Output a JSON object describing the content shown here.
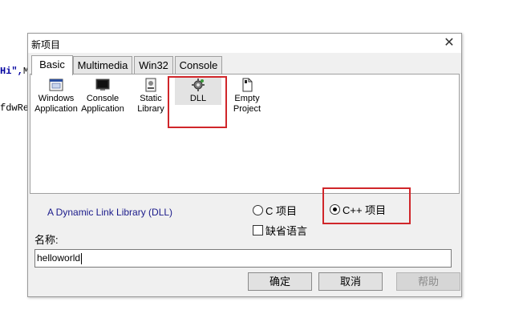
{
  "background": {
    "code_line1_str": "Hi\",",
    "code_line1_rest": "M",
    "code_line2": "fdwRe"
  },
  "dialog": {
    "title": "新项目",
    "close_glyph": "✕",
    "tabs": [
      {
        "label": "Basic",
        "active": true
      },
      {
        "label": "Multimedia",
        "active": false
      },
      {
        "label": "Win32",
        "active": false
      },
      {
        "label": "Console",
        "active": false
      }
    ],
    "project_types": [
      {
        "line1": "Windows",
        "line2": "Application",
        "icon": "windows-app-icon"
      },
      {
        "line1": "Console",
        "line2": "Application",
        "icon": "console-app-icon"
      },
      {
        "line1": "Static",
        "line2": "Library",
        "icon": "static-library-icon"
      },
      {
        "line1": "DLL",
        "line2": "",
        "icon": "dll-gear-icon",
        "selected": true
      },
      {
        "line1": "Empty",
        "line2": "Project",
        "icon": "empty-project-icon"
      }
    ],
    "description": "A Dynamic Link Library (DLL)",
    "lang_c": "C 项目",
    "lang_cpp": "C++ 项目",
    "lang_selected": "C++",
    "default_lang_checkbox": "缺省语言",
    "default_lang_checked": false,
    "name_label": "名称:",
    "name_value": "helloworld",
    "buttons": {
      "ok": "确定",
      "cancel": "取消",
      "help": "帮助"
    },
    "highlight_color": "#d0262a"
  }
}
